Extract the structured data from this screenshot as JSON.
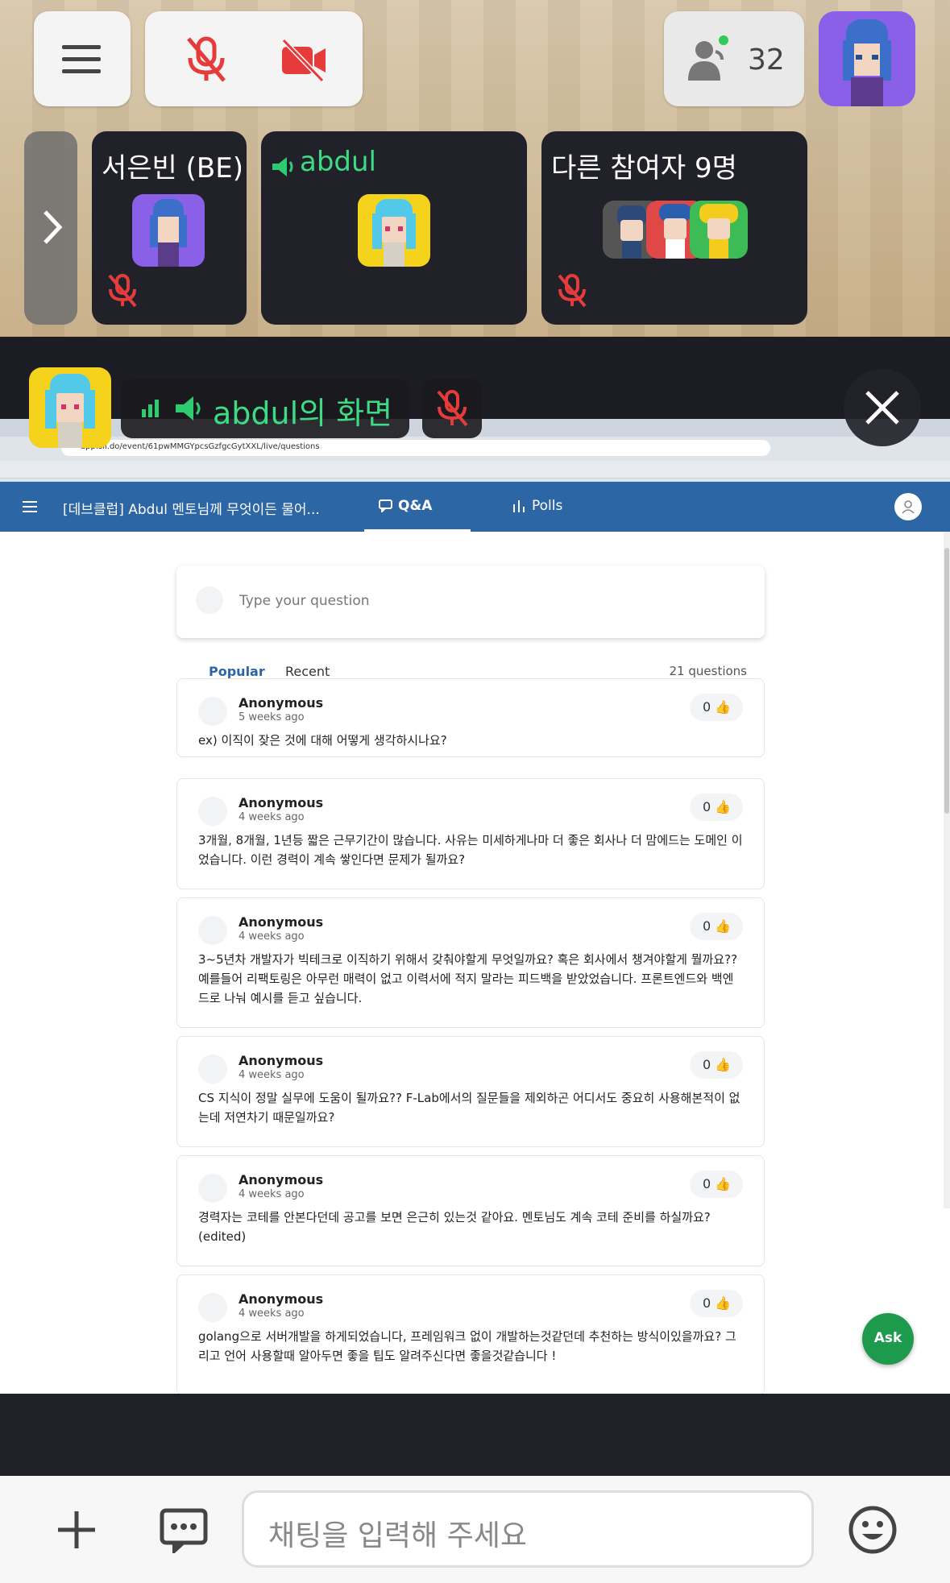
{
  "top_bar": {
    "participant_count": "32"
  },
  "tiles": [
    {
      "name": "서은빈 (BE)"
    },
    {
      "name": "abdul"
    },
    {
      "name": "다른 참여자 9명"
    }
  ],
  "share": {
    "title": "abdul의 화면"
  },
  "browser": {
    "url": "app.sli.do/event/61pwMMGYpcsGzfgcGytXXL/live/questions"
  },
  "slido": {
    "event_title": "[데브클럽] Abdul 멘토님께 무엇이든 물어...",
    "tabs": [
      "Q&A",
      "Polls"
    ],
    "input_placeholder": "Type your question",
    "sort_tabs": [
      "Popular",
      "Recent"
    ],
    "question_count": "21 questions",
    "questions": [
      {
        "author": "Anonymous",
        "time": "5 weeks ago",
        "likes": "0",
        "text": "ex) 이직이 잦은 것에 대해 어떻게 생각하시나요?"
      },
      {
        "author": "Anonymous",
        "time": "4 weeks ago",
        "likes": "0",
        "text": "3개월, 8개월, 1년등 짧은 근무기간이 많습니다. 사유는 미세하게나마 더 좋은 회사나 더 맘에드는 도메인 이었습니다. 이런 경력이 계속 쌓인다면 문제가 될까요?"
      },
      {
        "author": "Anonymous",
        "time": "4 weeks ago",
        "likes": "0",
        "text": "3~5년차 개발자가 빅테크로 이직하기 위해서 갖춰야할게 무엇일까요? 혹은 회사에서 챙겨야할게 뭘까요?? 예를들어 리팩토링은 아무런 매력이 없고 이력서에 적지 말라는 피드백을 받았었습니다. 프론트엔드와 백엔드로 나눠 예시를 듣고 싶습니다."
      },
      {
        "author": "Anonymous",
        "time": "4 weeks ago",
        "likes": "0",
        "text": "CS 지식이 정말 실무에 도움이 될까요?? F-Lab에서의 질문들을 제외하곤 어디서도 중요히 사용해본적이 없는데 저연차기 때문일까요?"
      },
      {
        "author": "Anonymous",
        "time": "4 weeks ago",
        "likes": "0",
        "text": "경력자는 코테를 안본다던데 공고를 보면 은근히 있는것 같아요. 멘토님도 계속 코테 준비를 하실까요? (edited)"
      },
      {
        "author": "Anonymous",
        "time": "4 weeks ago",
        "likes": "0",
        "text": "golang으로 서버개발을 하게되었습니다, 프레임워크 없이 개발하는것같던데 추천하는 방식이있을까요? 그리고 언어 사용할때 알아두면 좋을 팁도 알려주신다면 좋을것같습니다 !"
      }
    ],
    "ask_label": "Ask"
  },
  "chat": {
    "placeholder": "채팅을 입력해 주세요"
  }
}
